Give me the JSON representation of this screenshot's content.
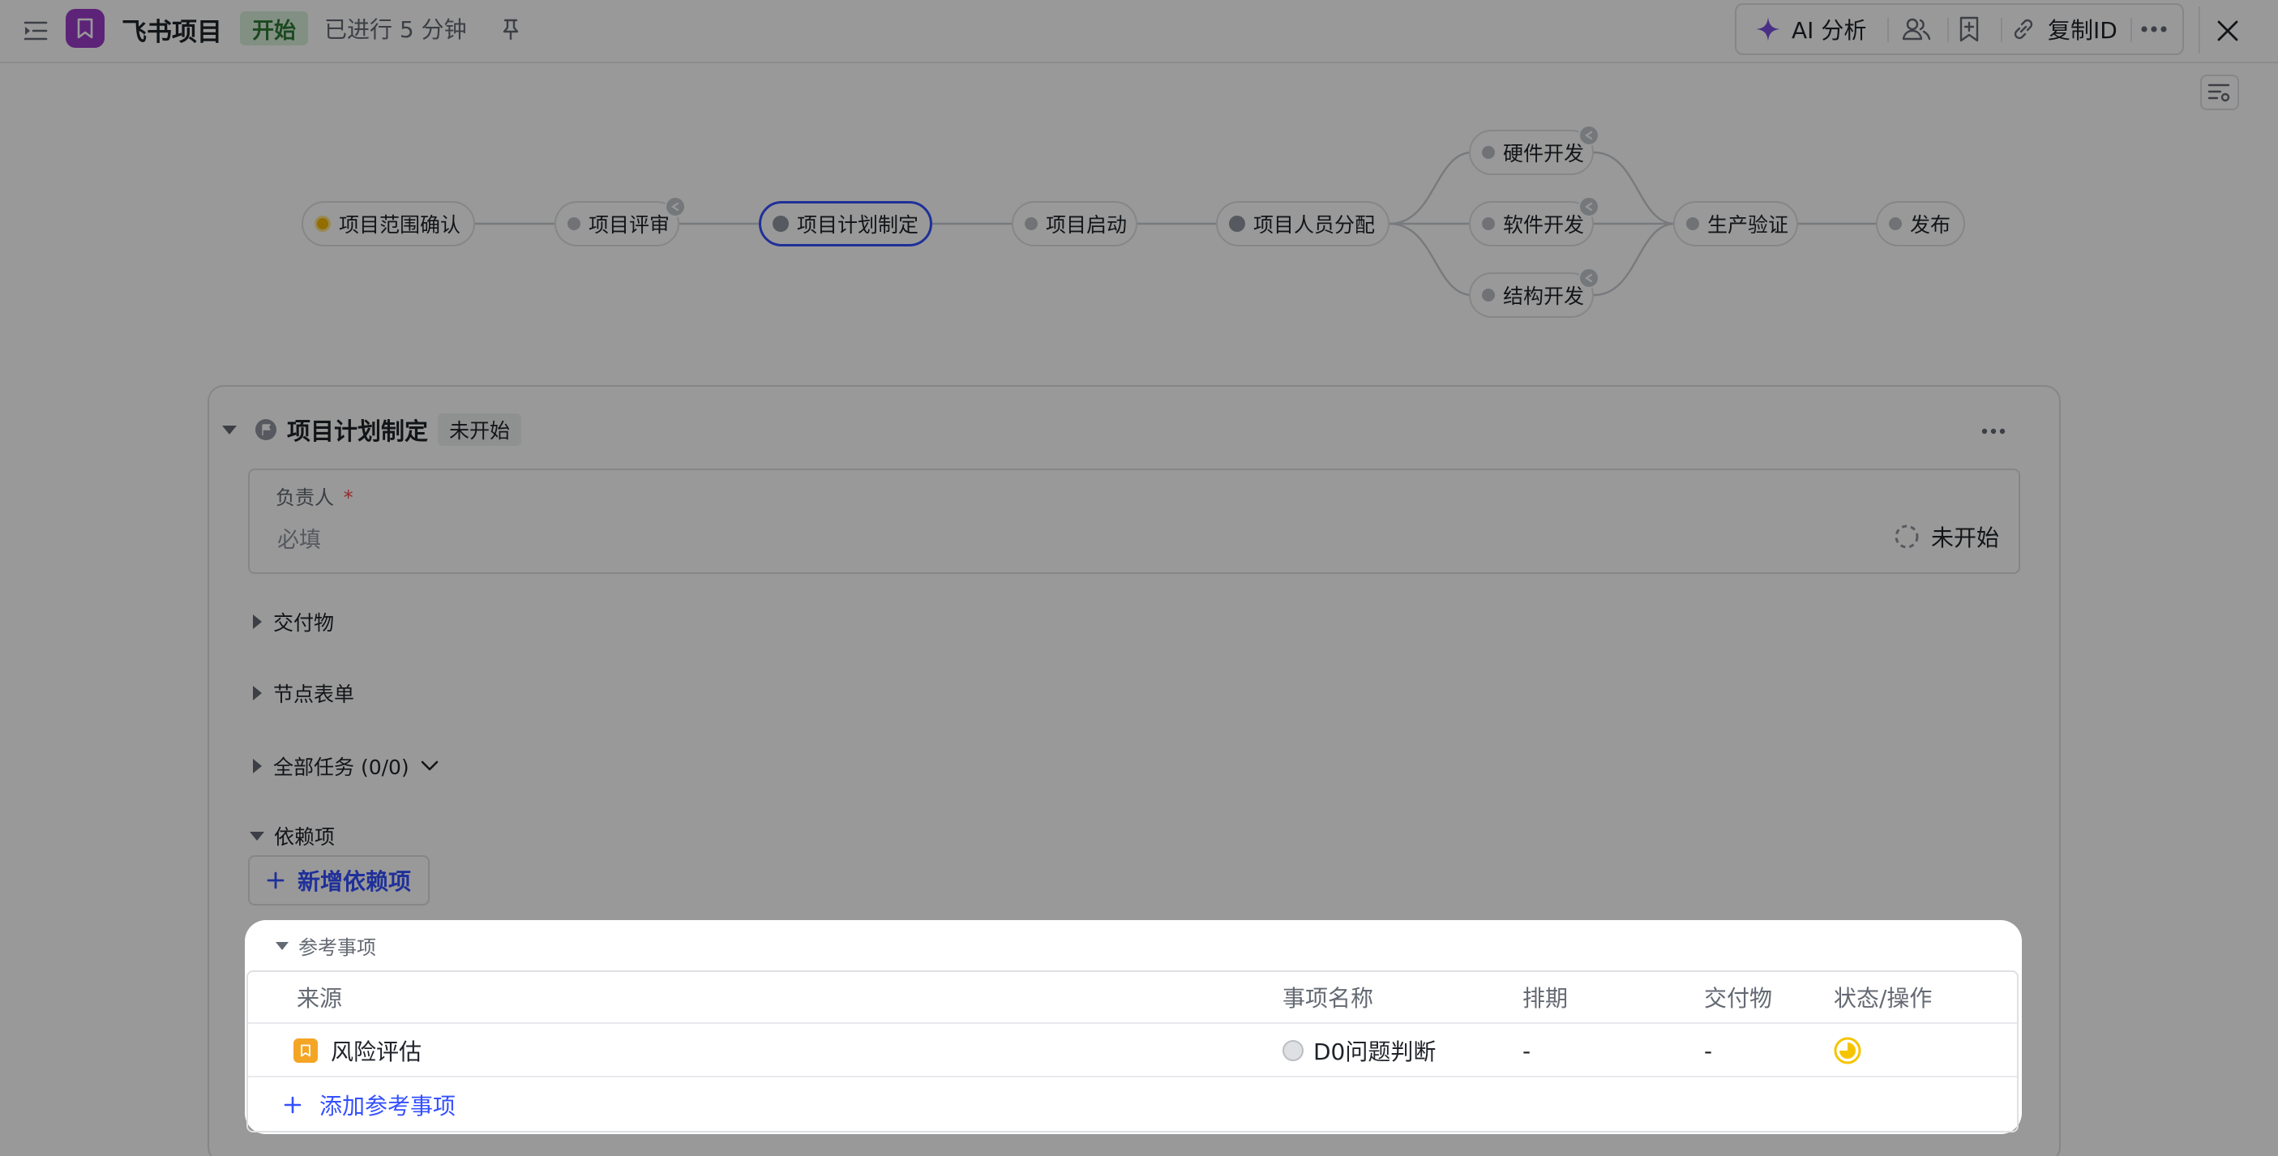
{
  "header": {
    "title": "飞书项目",
    "state_tag": "开始",
    "elapsed": "已进行 5 分钟",
    "toolbar": {
      "ai_label": "AI 分析",
      "copy_id_label": "复制ID"
    }
  },
  "workflow": {
    "nodes": [
      {
        "label": "项目范围确认"
      },
      {
        "label": "项目评审"
      },
      {
        "label": "项目计划制定"
      },
      {
        "label": "项目启动"
      },
      {
        "label": "项目人员分配"
      },
      {
        "label": "硬件开发"
      },
      {
        "label": "软件开发"
      },
      {
        "label": "结构开发"
      },
      {
        "label": "生产验证"
      },
      {
        "label": "发布"
      }
    ]
  },
  "panel": {
    "title": "项目计划制定",
    "status": "未开始",
    "owner_label": "负责人",
    "owner_required_mark": "*",
    "owner_placeholder": "必填",
    "owner_status": "未开始",
    "sections": {
      "deliverables": "交付物",
      "node_form": "节点表单",
      "all_tasks": "全部任务 (0/0)",
      "dependencies": "依赖项"
    },
    "add_dependency": "新增依赖项"
  },
  "reference": {
    "section_label": "参考事项",
    "columns": [
      "来源",
      "事项名称",
      "排期",
      "交付物",
      "状态/操作"
    ],
    "rows": [
      {
        "source": "风险评估",
        "name": "D0问题判断",
        "schedule": "-",
        "deliverable": "-"
      }
    ],
    "add_label": "添加参考事项"
  },
  "colors": {
    "accent": "#3450ff",
    "app_logo": "#9b3bc8",
    "start_tag_bg": "#d9f1dc",
    "source_icon": "#f5a524",
    "status_yellow": "#f5c400"
  }
}
